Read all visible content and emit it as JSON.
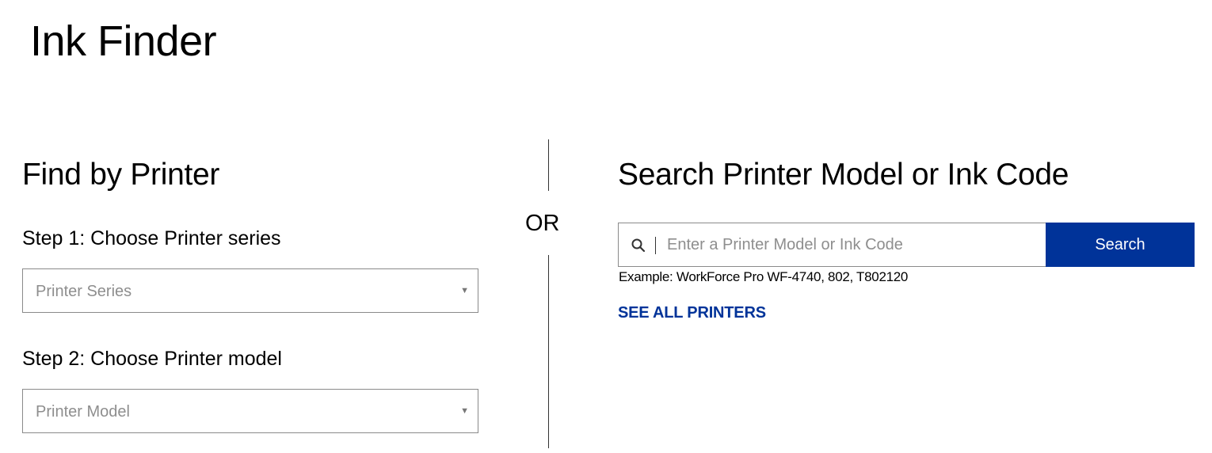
{
  "page": {
    "title": "Ink Finder"
  },
  "find_by_printer": {
    "title": "Find by Printer",
    "step1_label": "Step 1: Choose Printer series",
    "series_select": {
      "selected": "Printer Series",
      "arrow_icon": "triangle-down-icon"
    },
    "step2_label": "Step 2: Choose Printer model",
    "model_select": {
      "selected": "Printer Model",
      "arrow_icon": "triangle-down-icon"
    }
  },
  "divider": {
    "label": "OR"
  },
  "search": {
    "title": "Search Printer Model or Ink Code",
    "input_value": "",
    "placeholder": "Enter a Printer Model or Ink Code",
    "icon": "search-icon",
    "button_label": "Search",
    "example": "Example: WorkForce Pro WF-4740, 802, T802120",
    "see_all_label": "SEE ALL PRINTERS"
  },
  "colors": {
    "accent": "#003399",
    "border": "#8a8a8a",
    "placeholder": "#8e8e8e"
  }
}
